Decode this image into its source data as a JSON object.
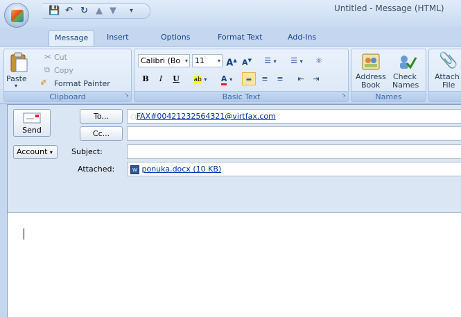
{
  "window": {
    "title": "Untitled - Message (HTML)"
  },
  "tabs": [
    {
      "label": "Message",
      "active": true
    },
    {
      "label": "Insert"
    },
    {
      "label": "Options"
    },
    {
      "label": "Format Text"
    },
    {
      "label": "Add-Ins"
    }
  ],
  "ribbon": {
    "clipboard": {
      "label": "Clipboard",
      "paste": "Paste",
      "cut": "Cut",
      "copy": "Copy",
      "format_painter": "Format Painter"
    },
    "basic_text": {
      "label": "Basic Text",
      "font": "Calibri (Bo",
      "size": "11",
      "grow_font": "A",
      "shrink_font": "A",
      "bold": "B",
      "italic": "I",
      "underline": "U",
      "highlight": "ab",
      "font_color": "A"
    },
    "names": {
      "label": "Names",
      "address_book_line1": "Address",
      "address_book_line2": "Book",
      "check_names_line1": "Check",
      "check_names_line2": "Names"
    },
    "attach": {
      "line1": "Attach",
      "line2": "File"
    }
  },
  "compose": {
    "send": "Send",
    "to_button": "To...",
    "cc_button": "Cc...",
    "account_button": "Account",
    "subject_label": "Subject:",
    "attached_label": "Attached:",
    "to_value": "FAX#00421232564321@virtfax.com",
    "cc_value": "",
    "subject_value": "",
    "attachment": "ponuka.docx (10 KB)"
  },
  "colors": {
    "ribbon_bg": "#d6e5f7",
    "tab_text": "#15428b",
    "link": "#0033aa",
    "highlight_active": "#fde7a0"
  }
}
